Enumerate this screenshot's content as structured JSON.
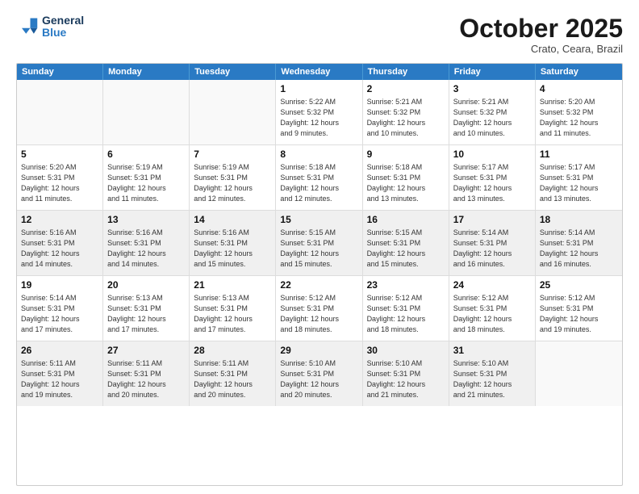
{
  "logo": {
    "line1": "General",
    "line2": "Blue"
  },
  "header": {
    "month": "October 2025",
    "location": "Crato, Ceara, Brazil"
  },
  "weekdays": [
    "Sunday",
    "Monday",
    "Tuesday",
    "Wednesday",
    "Thursday",
    "Friday",
    "Saturday"
  ],
  "rows": [
    [
      {
        "day": "",
        "info": "",
        "empty": true
      },
      {
        "day": "",
        "info": "",
        "empty": true
      },
      {
        "day": "",
        "info": "",
        "empty": true
      },
      {
        "day": "1",
        "info": "Sunrise: 5:22 AM\nSunset: 5:32 PM\nDaylight: 12 hours\nand 9 minutes."
      },
      {
        "day": "2",
        "info": "Sunrise: 5:21 AM\nSunset: 5:32 PM\nDaylight: 12 hours\nand 10 minutes."
      },
      {
        "day": "3",
        "info": "Sunrise: 5:21 AM\nSunset: 5:32 PM\nDaylight: 12 hours\nand 10 minutes."
      },
      {
        "day": "4",
        "info": "Sunrise: 5:20 AM\nSunset: 5:32 PM\nDaylight: 12 hours\nand 11 minutes."
      }
    ],
    [
      {
        "day": "5",
        "info": "Sunrise: 5:20 AM\nSunset: 5:31 PM\nDaylight: 12 hours\nand 11 minutes."
      },
      {
        "day": "6",
        "info": "Sunrise: 5:19 AM\nSunset: 5:31 PM\nDaylight: 12 hours\nand 11 minutes."
      },
      {
        "day": "7",
        "info": "Sunrise: 5:19 AM\nSunset: 5:31 PM\nDaylight: 12 hours\nand 12 minutes."
      },
      {
        "day": "8",
        "info": "Sunrise: 5:18 AM\nSunset: 5:31 PM\nDaylight: 12 hours\nand 12 minutes."
      },
      {
        "day": "9",
        "info": "Sunrise: 5:18 AM\nSunset: 5:31 PM\nDaylight: 12 hours\nand 13 minutes."
      },
      {
        "day": "10",
        "info": "Sunrise: 5:17 AM\nSunset: 5:31 PM\nDaylight: 12 hours\nand 13 minutes."
      },
      {
        "day": "11",
        "info": "Sunrise: 5:17 AM\nSunset: 5:31 PM\nDaylight: 12 hours\nand 13 minutes."
      }
    ],
    [
      {
        "day": "12",
        "info": "Sunrise: 5:16 AM\nSunset: 5:31 PM\nDaylight: 12 hours\nand 14 minutes.",
        "shaded": true
      },
      {
        "day": "13",
        "info": "Sunrise: 5:16 AM\nSunset: 5:31 PM\nDaylight: 12 hours\nand 14 minutes.",
        "shaded": true
      },
      {
        "day": "14",
        "info": "Sunrise: 5:16 AM\nSunset: 5:31 PM\nDaylight: 12 hours\nand 15 minutes.",
        "shaded": true
      },
      {
        "day": "15",
        "info": "Sunrise: 5:15 AM\nSunset: 5:31 PM\nDaylight: 12 hours\nand 15 minutes.",
        "shaded": true
      },
      {
        "day": "16",
        "info": "Sunrise: 5:15 AM\nSunset: 5:31 PM\nDaylight: 12 hours\nand 15 minutes.",
        "shaded": true
      },
      {
        "day": "17",
        "info": "Sunrise: 5:14 AM\nSunset: 5:31 PM\nDaylight: 12 hours\nand 16 minutes.",
        "shaded": true
      },
      {
        "day": "18",
        "info": "Sunrise: 5:14 AM\nSunset: 5:31 PM\nDaylight: 12 hours\nand 16 minutes.",
        "shaded": true
      }
    ],
    [
      {
        "day": "19",
        "info": "Sunrise: 5:14 AM\nSunset: 5:31 PM\nDaylight: 12 hours\nand 17 minutes."
      },
      {
        "day": "20",
        "info": "Sunrise: 5:13 AM\nSunset: 5:31 PM\nDaylight: 12 hours\nand 17 minutes."
      },
      {
        "day": "21",
        "info": "Sunrise: 5:13 AM\nSunset: 5:31 PM\nDaylight: 12 hours\nand 17 minutes."
      },
      {
        "day": "22",
        "info": "Sunrise: 5:12 AM\nSunset: 5:31 PM\nDaylight: 12 hours\nand 18 minutes."
      },
      {
        "day": "23",
        "info": "Sunrise: 5:12 AM\nSunset: 5:31 PM\nDaylight: 12 hours\nand 18 minutes."
      },
      {
        "day": "24",
        "info": "Sunrise: 5:12 AM\nSunset: 5:31 PM\nDaylight: 12 hours\nand 18 minutes."
      },
      {
        "day": "25",
        "info": "Sunrise: 5:12 AM\nSunset: 5:31 PM\nDaylight: 12 hours\nand 19 minutes."
      }
    ],
    [
      {
        "day": "26",
        "info": "Sunrise: 5:11 AM\nSunset: 5:31 PM\nDaylight: 12 hours\nand 19 minutes.",
        "shaded": true
      },
      {
        "day": "27",
        "info": "Sunrise: 5:11 AM\nSunset: 5:31 PM\nDaylight: 12 hours\nand 20 minutes.",
        "shaded": true
      },
      {
        "day": "28",
        "info": "Sunrise: 5:11 AM\nSunset: 5:31 PM\nDaylight: 12 hours\nand 20 minutes.",
        "shaded": true
      },
      {
        "day": "29",
        "info": "Sunrise: 5:10 AM\nSunset: 5:31 PM\nDaylight: 12 hours\nand 20 minutes.",
        "shaded": true
      },
      {
        "day": "30",
        "info": "Sunrise: 5:10 AM\nSunset: 5:31 PM\nDaylight: 12 hours\nand 21 minutes.",
        "shaded": true
      },
      {
        "day": "31",
        "info": "Sunrise: 5:10 AM\nSunset: 5:31 PM\nDaylight: 12 hours\nand 21 minutes.",
        "shaded": true
      },
      {
        "day": "",
        "info": "",
        "empty": true,
        "shaded": false
      }
    ]
  ]
}
